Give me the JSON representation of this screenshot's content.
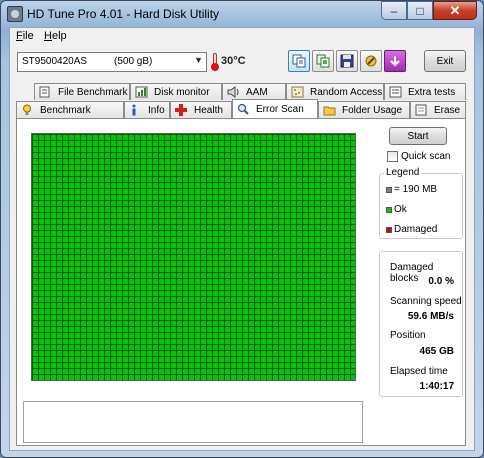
{
  "window": {
    "title": "HD Tune Pro 4.01 - Hard Disk Utility",
    "caption_minimize": "‒",
    "caption_maximize": "□",
    "caption_close": "✕"
  },
  "menu": {
    "file_label": "File",
    "help_label": "Help"
  },
  "toolbar": {
    "drive_model": "ST9500420AS",
    "drive_size": "(500 gB)",
    "temperature": "30°C",
    "exit_label": "Exit"
  },
  "tabs": {
    "row1": [
      "File Benchmark",
      "Disk monitor",
      "AAM",
      "Random Access",
      "Extra tests"
    ],
    "row2": [
      "Benchmark",
      "Info",
      "Health",
      "Error Scan",
      "Folder Usage",
      "Erase"
    ],
    "selected": "Error Scan"
  },
  "scan": {
    "start_label": "Start",
    "quick_scan_label": "Quick scan",
    "quick_scan_checked": false
  },
  "legend": {
    "title": "Legend",
    "block_label": "= 190 MB",
    "ok_label": "Ok",
    "damaged_label": "Damaged",
    "block_color": "#808080",
    "ok_color": "#00c800",
    "damaged_color": "#d40000"
  },
  "stats": {
    "damaged_blocks_label": "Damaged blocks",
    "damaged_blocks_value": "0.0 %",
    "scanning_speed_label": "Scanning speed",
    "scanning_speed_value": "59.6 MB/s",
    "position_label": "Position",
    "position_value": "465 GB",
    "elapsed_label": "Elapsed time",
    "elapsed_value": "1:40:17"
  }
}
